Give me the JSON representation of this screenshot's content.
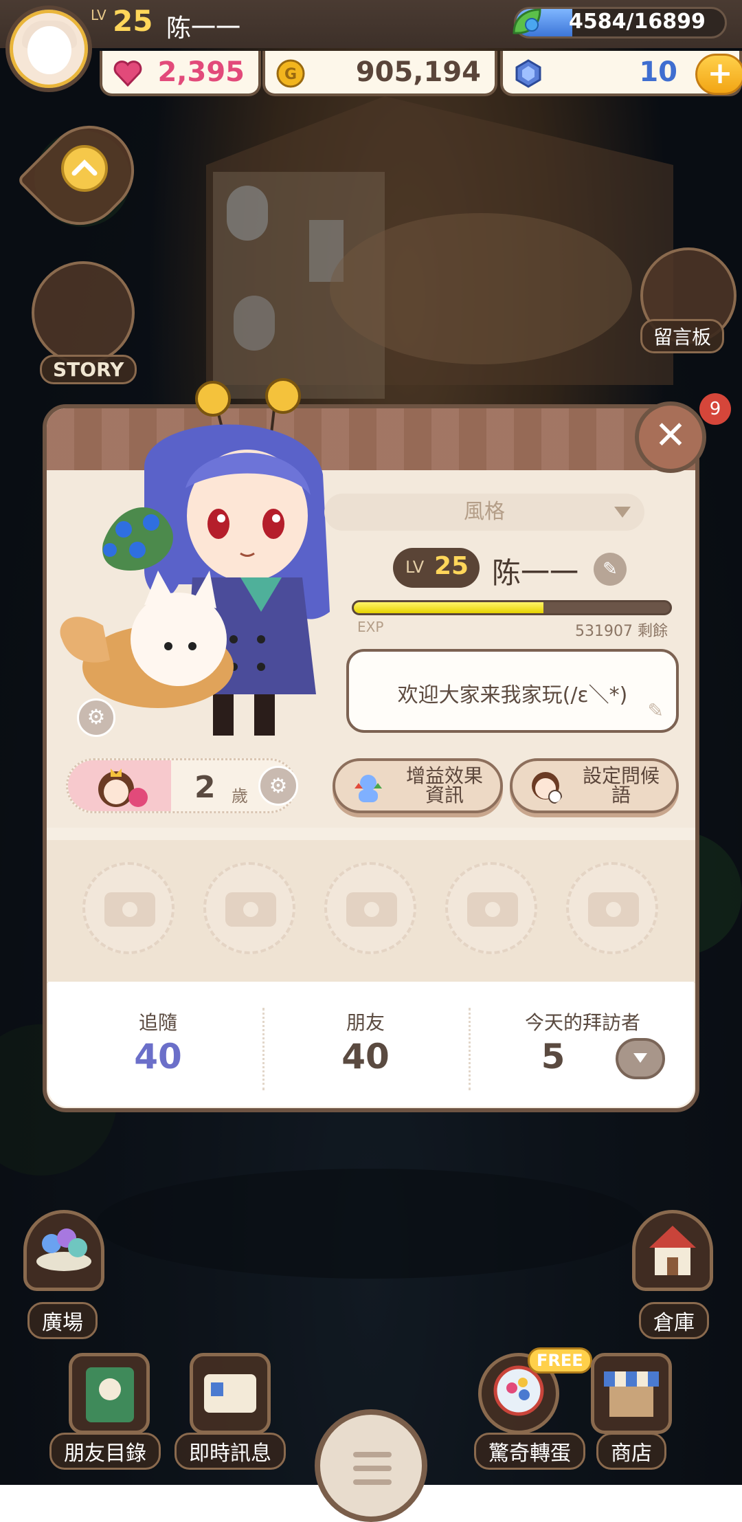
{
  "hud": {
    "level_label": "LV",
    "level": "25",
    "player_name": "陈一一",
    "exp_text": "4584/16899",
    "exp_fraction": 0.271,
    "hearts": "2,395",
    "gold": "905,194",
    "gems": "10"
  },
  "side": {
    "story_label": "STORY",
    "message_board_label": "留言板",
    "notification_count": "9"
  },
  "profile": {
    "style_select": "風格",
    "level_label": "LV",
    "level": "25",
    "name": "陈一一",
    "exp_label": "EXP",
    "exp_remaining": "531907 剩餘",
    "exp_fraction": 0.6,
    "greeting": "欢迎大家来我家玩(/ε＼*)",
    "age": "2",
    "age_unit": "歲",
    "buff_button": "增益效果資訊",
    "greet_button": "設定問候語",
    "photo_slots": 5,
    "stats": [
      {
        "label": "追隨",
        "value": "40",
        "color": "#6b6fc9"
      },
      {
        "label": "朋友",
        "value": "40",
        "color": "#5a4a40"
      },
      {
        "label": "今天的拜訪者",
        "value": "5",
        "color": "#5a4a40"
      }
    ]
  },
  "nav": {
    "plaza": "廣場",
    "warehouse": "倉庫",
    "friends_list": "朋友目錄",
    "instant_message": "即時訊息",
    "surprise_egg": "驚奇轉蛋",
    "free_badge": "FREE",
    "shop": "商店"
  },
  "colors": {
    "accent_gold": "#ffd65a",
    "follow_blue": "#6b6fc9",
    "heart_pink": "#e24a7a",
    "panel_brown": "#6e5443"
  }
}
